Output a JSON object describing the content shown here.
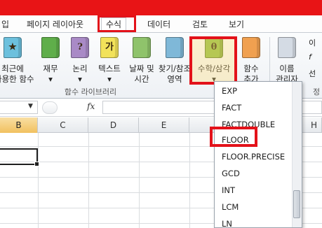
{
  "tabs": {
    "partial": "입",
    "page_layout": "페이지 레이아웃",
    "formulas": "수식",
    "data": "데이터",
    "review": "검토",
    "view": "보기"
  },
  "ribbon": {
    "recent": [
      "최근에",
      "사용한 함수"
    ],
    "financial": [
      "재무"
    ],
    "logical": [
      "논리"
    ],
    "text": [
      "텍스트"
    ],
    "datetime": [
      "날짜 및",
      "시간"
    ],
    "lookup": [
      "찾기/참조",
      "영역"
    ],
    "math": [
      "수학/삼각"
    ],
    "more": [
      "함수",
      "추가"
    ],
    "names": [
      "이름",
      "관리자"
    ],
    "group_label": "함수 라이브러리",
    "icon_glyphs": {
      "logical": "?",
      "text": "가",
      "math": "θ"
    },
    "side_right_1": "이",
    "side_right_2": "f",
    "side_right_3": "선",
    "section_label_cut": "정"
  },
  "formula_bar": {
    "fx": "fx"
  },
  "columns": [
    "B",
    "C",
    "D",
    "E",
    "H"
  ],
  "selected_column": "B",
  "dropdown_items": [
    "EXP",
    "FACT",
    "FACTDOUBLE",
    "FLOOR",
    "FLOOR.PRECISE",
    "GCD",
    "INT",
    "LCM",
    "LN"
  ],
  "highlighted_item": "FLOOR",
  "colors": {
    "title_red": "#e81416",
    "highlight_red": "#e3121a",
    "selected_header": "#f1c15f"
  }
}
